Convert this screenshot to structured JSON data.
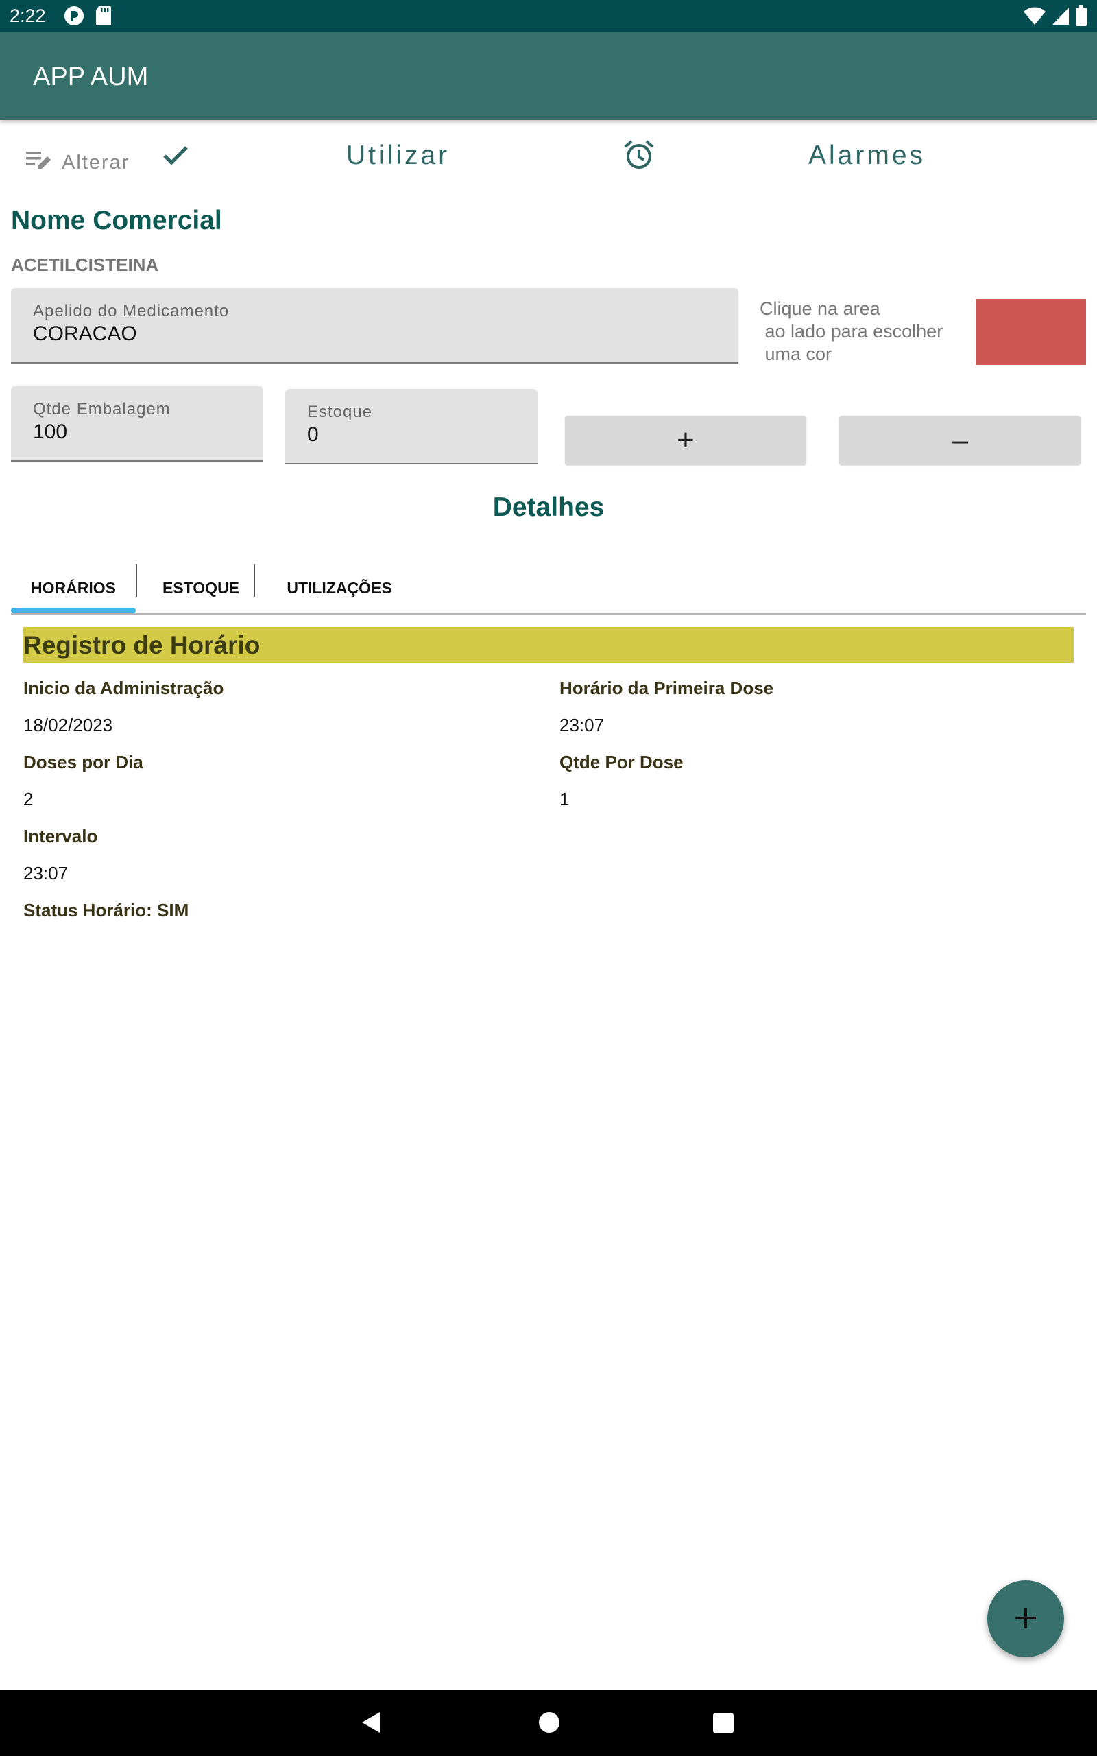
{
  "status_bar": {
    "time": "2:22",
    "left_icons": [
      "sync-icon",
      "sd-card-icon"
    ],
    "right_icons": [
      "wifi-icon",
      "signal-icon",
      "battery-icon"
    ]
  },
  "app_bar": {
    "title": "APP AUM",
    "color": "#35706b"
  },
  "toolbar": {
    "edit_label": "Alterar",
    "use_label": "Utilizar",
    "alarms_label": "Alarmes"
  },
  "product": {
    "section_title": "Nome Comercial",
    "commercial_name": "ACETILCISTEINA",
    "nickname_label": "Apelido do Medicamento",
    "nickname_value": "CORACAO",
    "color_hint": "Clique na area\n ao lado para escolher\n uma cor",
    "selected_color": "#cd5652",
    "qty_label": "Qtde Embalagem",
    "qty_value": "100",
    "stock_label": "Estoque",
    "stock_value": "0",
    "plus_label": "+",
    "minus_label": "–"
  },
  "details": {
    "title": "Detalhes",
    "tabs": [
      {
        "label": "HORÁRIOS",
        "selected": true
      },
      {
        "label": "ESTOQUE",
        "selected": false
      },
      {
        "label": "UTILIZAÇÕES",
        "selected": false
      }
    ],
    "indicator_color": "#3fb6e6"
  },
  "schedule": {
    "header": "Registro de Horário",
    "header_color": "#d3cb48",
    "start_label": "Inicio da Administração",
    "start_value": "18/02/2023",
    "first_dose_label": "Horário da Primeira Dose",
    "first_dose_value": "23:07",
    "doses_per_day_label": "Doses por Dia",
    "doses_per_day_value": "2",
    "qty_per_dose_label": "Qtde Por Dose",
    "qty_per_dose_value": "1",
    "interval_label": "Intervalo",
    "interval_value": "23:07",
    "status_label": "Status Horário: SIM"
  },
  "fab": {
    "icon": "plus-icon"
  },
  "nav_bar": {
    "icons": [
      "back-icon",
      "home-icon",
      "recents-icon"
    ]
  }
}
